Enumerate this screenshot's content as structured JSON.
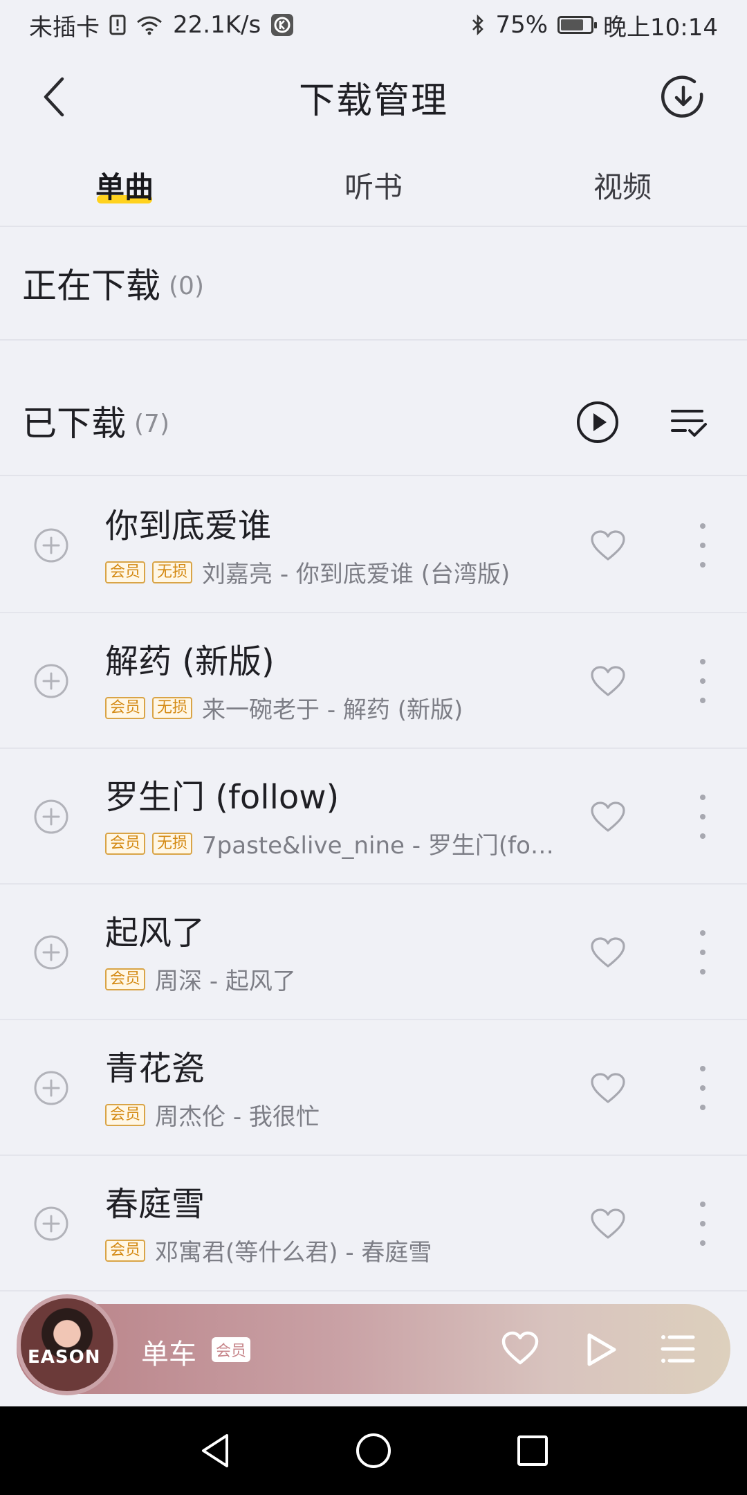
{
  "status_bar": {
    "sim": "未插卡",
    "speed": "22.1K/s",
    "battery": "75%",
    "battery_level": 0.75,
    "time": "晚上10:14"
  },
  "header": {
    "title": "下载管理"
  },
  "tabs": [
    {
      "label": "单曲",
      "active": true
    },
    {
      "label": "听书",
      "active": false
    },
    {
      "label": "视频",
      "active": false
    }
  ],
  "downloading": {
    "title": "正在下载",
    "count": "(0)"
  },
  "downloaded": {
    "title": "已下载",
    "count": "(7)"
  },
  "songs": [
    {
      "title": "你到底爱谁",
      "badges": [
        "会员",
        "无损"
      ],
      "subtitle": "刘嘉亮 - 你到底爱谁 (台湾版)"
    },
    {
      "title": "解药 (新版)",
      "badges": [
        "会员",
        "无损"
      ],
      "subtitle": "来一碗老于 - 解药 (新版)"
    },
    {
      "title": "罗生门 (follow)",
      "badges": [
        "会员",
        "无损"
      ],
      "subtitle": "7paste&live_nine - 罗生门(follo..."
    },
    {
      "title": "起风了",
      "badges": [
        "会员"
      ],
      "subtitle": "周深 - 起风了"
    },
    {
      "title": "青花瓷",
      "badges": [
        "会员"
      ],
      "subtitle": "周杰伦 - 我很忙"
    },
    {
      "title": "春庭雪",
      "badges": [
        "会员"
      ],
      "subtitle": "邓寓君(等什么君) - 春庭雪"
    }
  ],
  "player": {
    "title": "单车",
    "badge": "会员",
    "cover_text": "EASON"
  },
  "colors": {
    "accent_underline": "#ffd21e",
    "badge": "#d48a14",
    "background": "#f0f1f6"
  }
}
